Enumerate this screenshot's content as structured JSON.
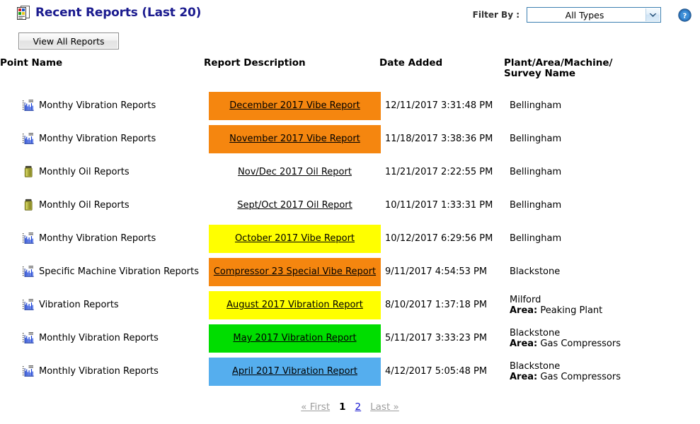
{
  "header": {
    "title": "Recent Reports (Last 20)",
    "icon": "report-list-icon",
    "filter_label": "Filter By :",
    "filter_value": "All Types",
    "filter_options": [
      "All Types"
    ],
    "help_icon": "help-question-icon",
    "view_all_label": "View All Reports"
  },
  "columns": {
    "point_name": "Point Name",
    "report_description": "Report Description",
    "date_added": "Date Added",
    "plant": "Plant/Area/Machine/",
    "plant2": "Survey Name"
  },
  "colors": {
    "orange": "#f5860f",
    "yellow": "#ffff00",
    "green": "#00dd00",
    "blue": "#55aeee",
    "none": "transparent",
    "title_blue": "#1b1b8f",
    "link_blue": "#1515cf"
  },
  "rows": [
    {
      "icon": "bar-chart-icon",
      "point_name": "Monthy Vibration Reports",
      "description": "December 2017 Vibe Report",
      "highlight": "#f5860f",
      "date_added": "12/11/2017 3:31:48 PM",
      "plant": "Bellingham",
      "area_label": "",
      "area_value": ""
    },
    {
      "icon": "bar-chart-icon",
      "point_name": "Monthy Vibration Reports",
      "description": "November 2017 Vibe Report",
      "highlight": "#f5860f",
      "date_added": "11/18/2017 3:38:36 PM",
      "plant": "Bellingham",
      "area_label": "",
      "area_value": ""
    },
    {
      "icon": "oil-jar-icon",
      "point_name": "Monthly Oil Reports",
      "description": "Nov/Dec 2017 Oil Report",
      "highlight": "transparent",
      "date_added": "11/21/2017 2:22:55 PM",
      "plant": "Bellingham",
      "area_label": "",
      "area_value": ""
    },
    {
      "icon": "oil-jar-icon",
      "point_name": "Monthly Oil Reports",
      "description": "Sept/Oct 2017 Oil Report",
      "highlight": "transparent",
      "date_added": "10/11/2017 1:33:31 PM",
      "plant": "Bellingham",
      "area_label": "",
      "area_value": ""
    },
    {
      "icon": "bar-chart-icon",
      "point_name": "Monthy Vibration Reports",
      "description": "October 2017 Vibe Report",
      "highlight": "#ffff00",
      "date_added": "10/12/2017 6:29:56 PM",
      "plant": "Bellingham",
      "area_label": "",
      "area_value": ""
    },
    {
      "icon": "bar-chart-icon",
      "point_name": "Specific Machine Vibration Reports",
      "description": "Compressor 23 Special Vibe Report",
      "highlight": "#f5860f",
      "date_added": "9/11/2017 4:54:53 PM",
      "plant": "Blackstone",
      "area_label": "",
      "area_value": ""
    },
    {
      "icon": "bar-chart-icon",
      "point_name": "Vibration Reports",
      "description": "August 2017 Vibration Report",
      "highlight": "#ffff00",
      "date_added": "8/10/2017 1:37:18 PM",
      "plant": "Milford",
      "area_label": "Area:",
      "area_value": "Peaking Plant"
    },
    {
      "icon": "bar-chart-icon",
      "point_name": "Monthly Vibration Reports",
      "description": "May 2017 Vibration Report",
      "highlight": "#00dd00",
      "date_added": "5/11/2017 3:33:23 PM",
      "plant": "Blackstone",
      "area_label": "Area:",
      "area_value": "Gas Compressors"
    },
    {
      "icon": "bar-chart-icon",
      "point_name": "Monthly Vibration Reports",
      "description": "April 2017 Vibration Report",
      "highlight": "#55aeee",
      "date_added": "4/12/2017 5:05:48 PM",
      "plant": "Blackstone",
      "area_label": "Area:",
      "area_value": "Gas Compressors"
    }
  ],
  "pagination": {
    "first": "« First",
    "last": "Last »",
    "pages": [
      "1",
      "2"
    ],
    "current": "1"
  }
}
